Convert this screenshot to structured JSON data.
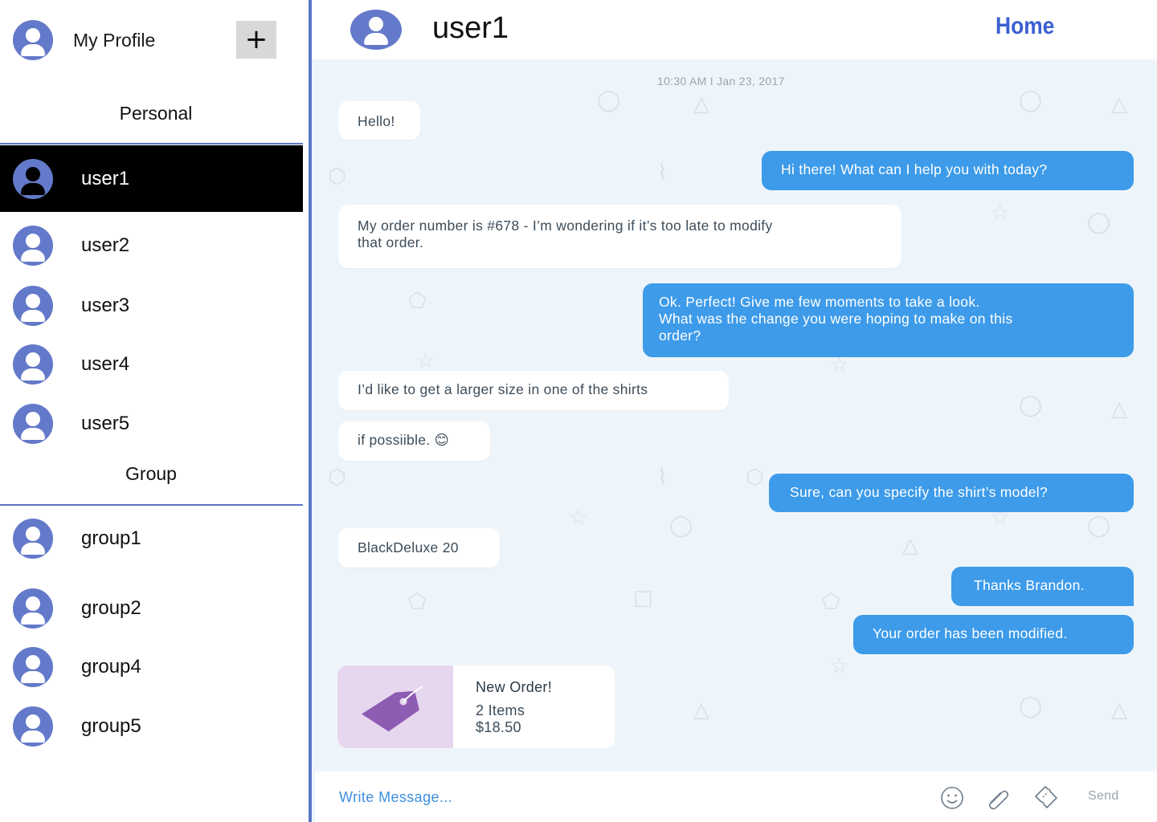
{
  "profile": {
    "label": "My Profile",
    "add_label": "+"
  },
  "sections": {
    "personal": "Personal",
    "group": "Group"
  },
  "users": [
    {
      "name": "user1",
      "active": true
    },
    {
      "name": "user2"
    },
    {
      "name": "user3"
    },
    {
      "name": "user4"
    },
    {
      "name": "user5"
    }
  ],
  "groups": [
    {
      "name": "group1"
    },
    {
      "name": "group2"
    },
    {
      "name": "group4"
    },
    {
      "name": "group5"
    }
  ],
  "chat": {
    "title": "user1",
    "home_link": "Home",
    "timestamp": "10:30 AM  I  Jan 23, 2017",
    "messages": [
      {
        "dir": "in",
        "lines": [
          "Hello!"
        ]
      },
      {
        "dir": "out",
        "lines": [
          "Hi there! What can I help you with today?"
        ]
      },
      {
        "dir": "in",
        "lines": [
          "My order number is #678 - I’m wondering if it’s too late to modify",
          "that order."
        ]
      },
      {
        "dir": "out",
        "lines": [
          "Ok. Perfect! Give me few moments to take a look.",
          "What was the change you were hoping to make on this",
          "order?"
        ]
      },
      {
        "dir": "in",
        "lines": [
          "I’d like to get a larger size in one of the shirts"
        ]
      },
      {
        "dir": "in",
        "lines": [
          "if possiible. 😊"
        ]
      },
      {
        "dir": "out",
        "lines": [
          "Sure, can you specify the shirt’s model?"
        ]
      },
      {
        "dir": "in",
        "lines": [
          "BlackDeluxe 20"
        ]
      },
      {
        "dir": "out",
        "lines": [
          "Thanks Brandon."
        ]
      },
      {
        "dir": "out",
        "lines": [
          "Your order has been modified."
        ]
      }
    ],
    "order_card": {
      "title": "New Order!",
      "items": "2 Items",
      "price": "$18.50"
    },
    "composer": {
      "placeholder": "Write Message...",
      "send_label": "Send"
    }
  },
  "colors": {
    "accent": "#3d9be9",
    "avatar": "#6379c9",
    "divider": "#5b76c8",
    "home": "#3a5fd1",
    "active_row": "#000000"
  }
}
